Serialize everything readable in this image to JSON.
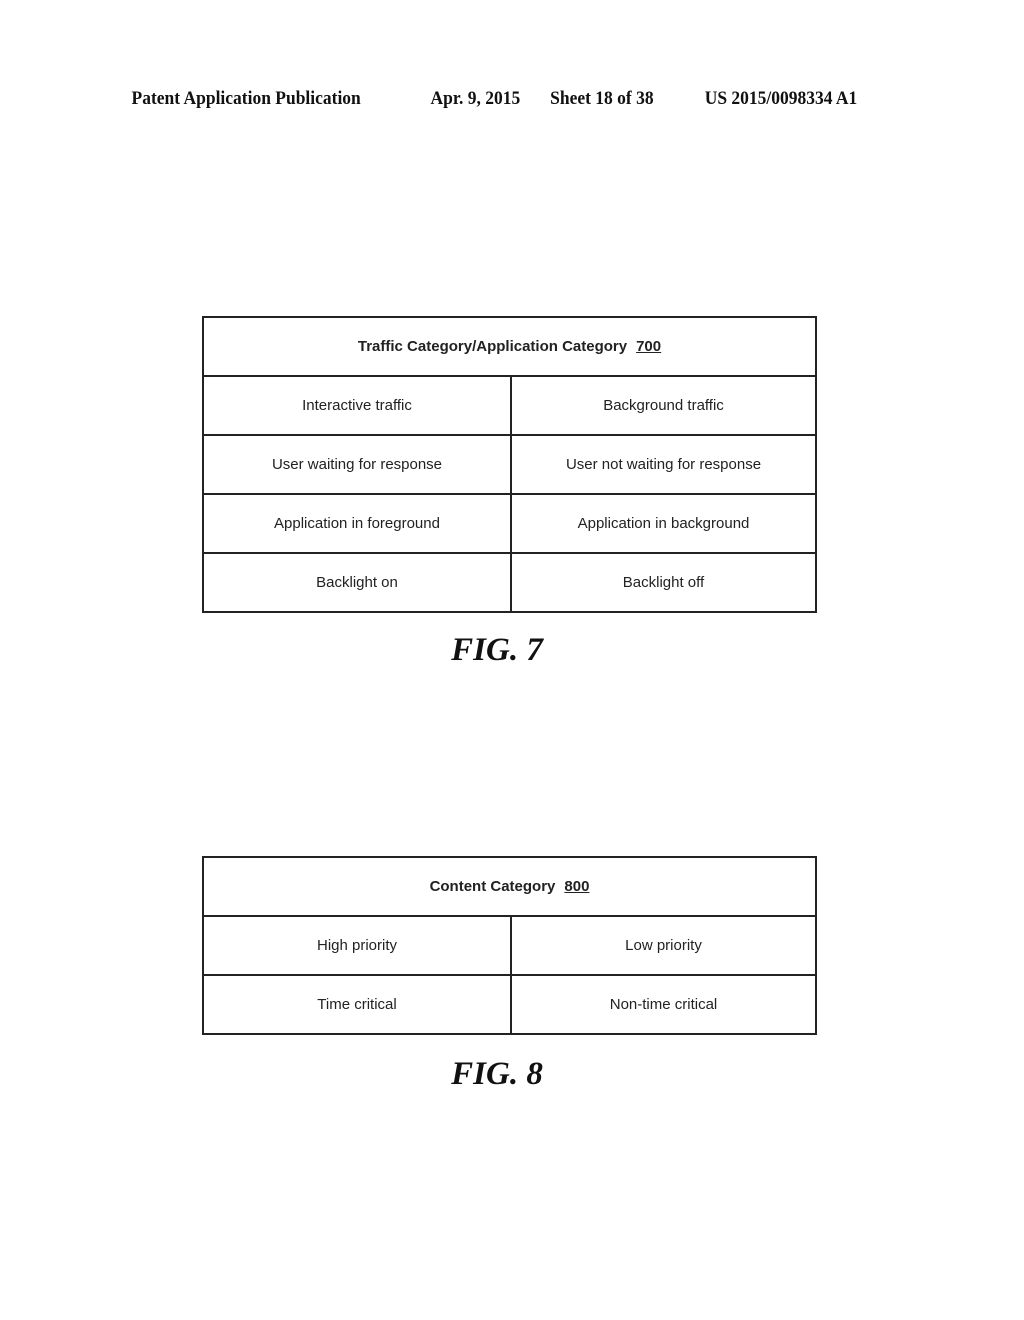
{
  "header": {
    "publication": "Patent Application Publication",
    "date": "Apr. 9, 2015",
    "sheet": "Sheet 18 of 38",
    "number": "US 2015/0098334 A1"
  },
  "figures": [
    {
      "caption": "FIG. 7",
      "table": {
        "title": "Traffic Category/Application Category",
        "ref": "700",
        "rows": [
          [
            "Interactive traffic",
            "Background traffic"
          ],
          [
            "User waiting for response",
            "User not waiting for response"
          ],
          [
            "Application in foreground",
            "Application in background"
          ],
          [
            "Backlight on",
            "Backlight off"
          ]
        ]
      }
    },
    {
      "caption": "FIG. 8",
      "table": {
        "title": "Content Category",
        "ref": "800",
        "rows": [
          [
            "High priority",
            "Low priority"
          ],
          [
            "Time critical",
            "Non-time critical"
          ]
        ]
      }
    }
  ]
}
